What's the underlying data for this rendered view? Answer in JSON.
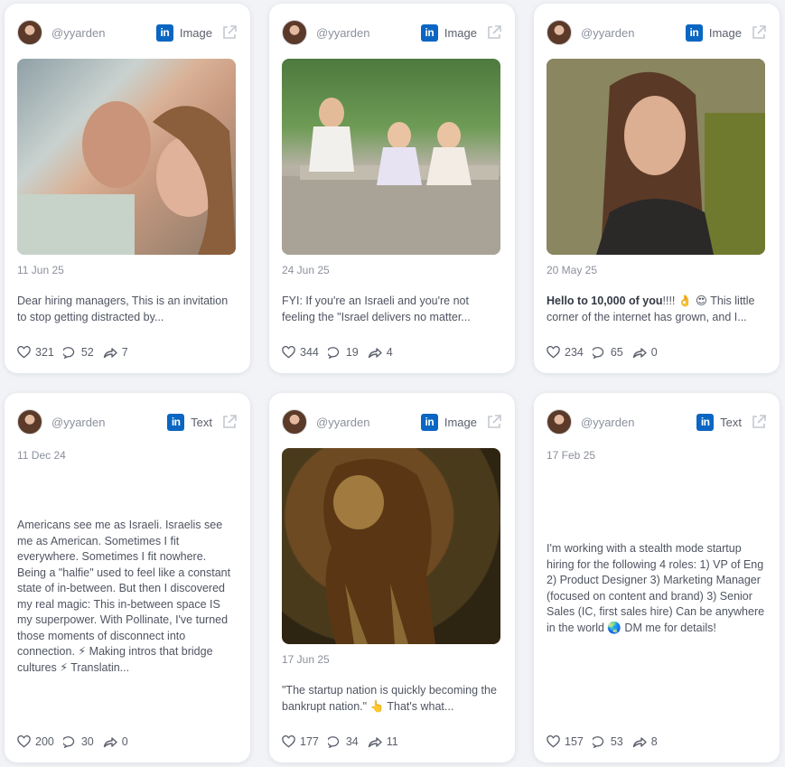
{
  "colors": {
    "linkedin": "#0a66c2",
    "card": "#ffffff",
    "background": "#f1f3f6"
  },
  "icons": {
    "platform": "linkedin-icon",
    "open": "external-link-icon",
    "like": "heart-icon",
    "comment": "comment-icon",
    "share": "share-icon"
  },
  "cards": [
    {
      "username": "@yyarden",
      "type": "Image",
      "date": "11 Jun 25",
      "text": "Dear hiring managers, This is an invitation to stop getting distracted by...",
      "likes": "321",
      "comments": "52",
      "shares": "7",
      "image_alt": "selfie of a smiling couple"
    },
    {
      "username": "@yyarden",
      "type": "Image",
      "date": "24 Jun 25",
      "text": "FYI: If you're an Israeli and you're not feeling the \"Israel delivers no matter...",
      "likes": "344",
      "comments": "19",
      "shares": "4",
      "image_alt": "woman sitting with two little girls on a bench"
    },
    {
      "username": "@yyarden",
      "type": "Image",
      "date": "20 May 25",
      "text_bold": "Hello to 10,000 of you",
      "text": "!!!! 👌 😍 This little corner of the internet has grown, and I...",
      "likes": "234",
      "comments": "65",
      "shares": "0",
      "image_alt": "portrait of a smiling woman"
    },
    {
      "username": "@yyarden",
      "type": "Text",
      "date": "11 Dec 24",
      "text": "Americans see me as Israeli. Israelis see me as American. Sometimes I fit everywhere. Sometimes I fit nowhere. Being a \"halfie\" used to feel like a constant state of in-between. But then I discovered my real magic: This in-between space IS my superpower. With Pollinate, I've turned those moments of disconnect into connection. ⚡ Making intros that bridge cultures ⚡ Translatin...",
      "likes": "200",
      "comments": "30",
      "shares": "0"
    },
    {
      "username": "@yyarden",
      "type": "Image",
      "date": "17 Jun 25",
      "text": "\"The startup nation is quickly becoming the bankrupt nation.\" 👆 That's what...",
      "likes": "177",
      "comments": "34",
      "shares": "11",
      "image_alt": "painting of a lion"
    },
    {
      "username": "@yyarden",
      "type": "Text",
      "date": "17 Feb 25",
      "text": "I'm working with a stealth mode startup hiring for the following 4 roles: 1) VP of Eng 2) Product Designer 3) Marketing Manager (focused on content and brand) 3) Senior Sales (IC, first sales hire) Can be anywhere in the world 🌏 DM me for details!",
      "likes": "157",
      "comments": "53",
      "shares": "8"
    }
  ]
}
